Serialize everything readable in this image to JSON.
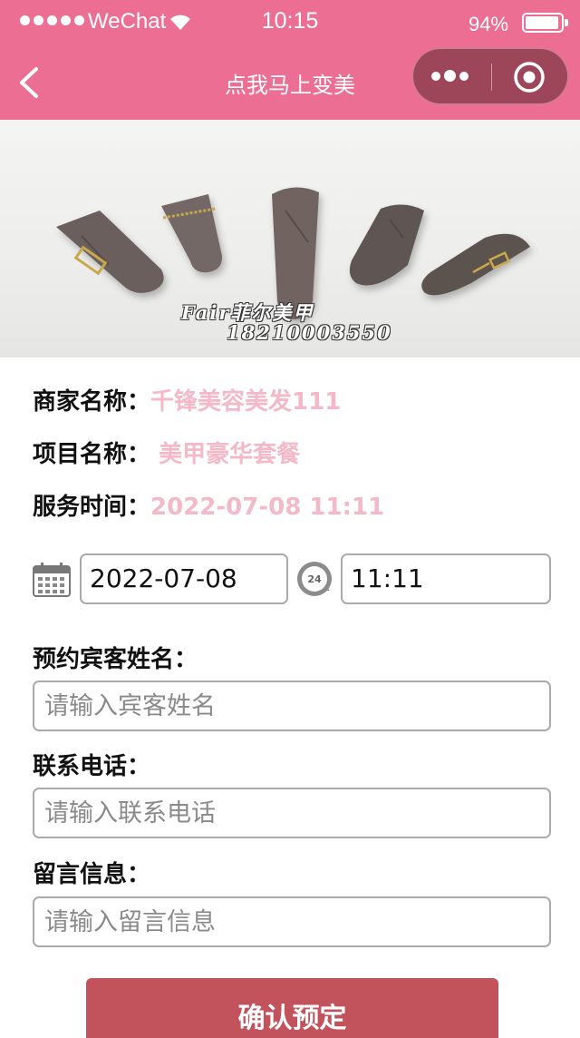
{
  "status_bar": {
    "carrier": "WeChat",
    "time": "10:15",
    "battery": "94%"
  },
  "nav": {
    "title": "点我马上变美"
  },
  "banner": {
    "watermark": "Fair菲尔美甲",
    "phone": "18210003550"
  },
  "info": {
    "merchant_label": "商家名称：",
    "merchant_value": "千锋美容美发111",
    "item_label": "项目名称：",
    "item_value": " 美甲豪华套餐",
    "service_time_label": "服务时间：",
    "service_time_value": "2022-07-08 11:11"
  },
  "picker": {
    "date": "2022-07-08",
    "time": "11:11",
    "clock_badge": "24"
  },
  "form": {
    "guest_label": "预约宾客姓名：",
    "guest_placeholder": "请输入宾客姓名",
    "phone_label": "联系电话：",
    "phone_placeholder": "请输入联系电话",
    "message_label": "留言信息：",
    "message_placeholder": "请输入留言信息"
  },
  "submit_label": "确认预定",
  "colors": {
    "nav_bg": "#ec6f93",
    "capsule_bg": "#9d4659",
    "info_value": "#f4b9c8",
    "submit_bg": "#c2535c",
    "nail_color": "#6b5e5c"
  }
}
